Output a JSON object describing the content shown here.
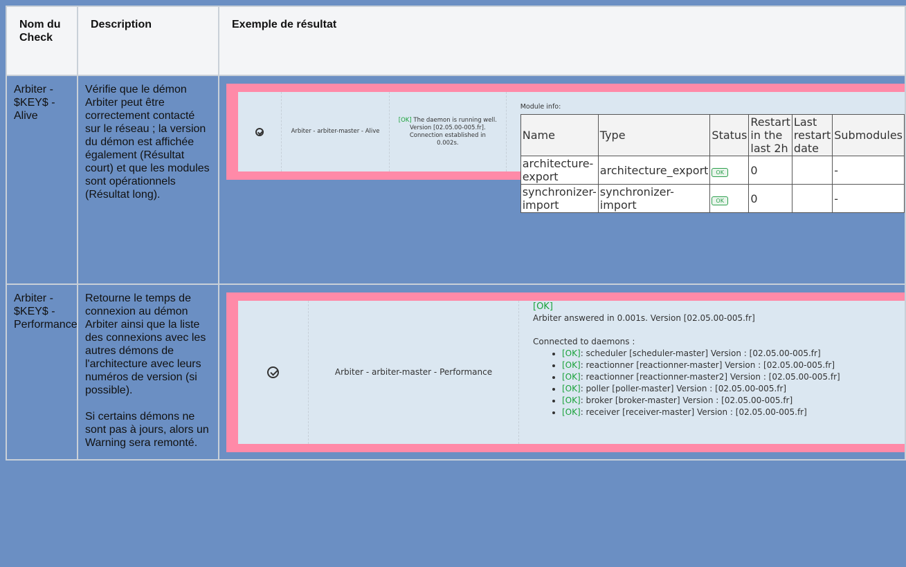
{
  "table": {
    "headers": [
      "Nom du Check",
      "Description",
      "Exemple de résultat"
    ],
    "rows": [
      {
        "name": "Arbiter - $KEY$ - Alive",
        "description": [
          "Vérifie que le démon Arbiter peut être correctement contacté sur le réseau ; la version du démon est affichée également (Résultat court) et que les modules sont opérationnels (Résultat long)."
        ],
        "example": {
          "check_name": "Arbiter - arbiter-master - Alive",
          "short_ok": "[OK]",
          "short_text": "The daemon is running well. Version [02.05.00-005.fr]. Connection established in 0.002s.",
          "module_title": "Module info:",
          "module_headers": [
            "Name",
            "Type",
            "Status",
            "Restart in the last 2h",
            "Last restart date",
            "Submodules"
          ],
          "modules": [
            {
              "name": "architecture-export",
              "type": "architecture_export",
              "status": "OK",
              "restarts": "0",
              "last_restart": "",
              "submodules": "-"
            },
            {
              "name": "synchronizer-import",
              "type": "synchronizer-import",
              "status": "OK",
              "restarts": "0",
              "last_restart": "",
              "submodules": "-"
            }
          ]
        }
      },
      {
        "name": "Arbiter - $KEY$ - Performance",
        "description": [
          "Retourne le temps de connexion au démon Arbiter ainsi que la liste des connexions avec les autres démons de l'architecture avec leurs numéros de version (si possible).",
          "Si certains démons ne sont pas à jours, alors un Warning sera remonté."
        ],
        "example": {
          "check_name": "Arbiter - arbiter-master - Performance",
          "ok_head": "[OK]",
          "answer_line": "Arbiter answered in 0.001s. Version [02.05.00-005.fr]",
          "connected_title": "Connected to daemons :",
          "daemons": [
            {
              "ok": "[OK]",
              "text": ": scheduler [scheduler-master] Version : [02.05.00-005.fr]"
            },
            {
              "ok": "[OK]",
              "text": ": reactionner [reactionner-master] Version : [02.05.00-005.fr]"
            },
            {
              "ok": "[OK]",
              "text": ": reactionner [reactionner-master2] Version : [02.05.00-005.fr]"
            },
            {
              "ok": "[OK]",
              "text": ": poller [poller-master] Version : [02.05.00-005.fr]"
            },
            {
              "ok": "[OK]",
              "text": ": broker [broker-master] Version : [02.05.00-005.fr]"
            },
            {
              "ok": "[OK]",
              "text": ": receiver [receiver-master] Version : [02.05.00-005.fr]"
            }
          ]
        }
      }
    ]
  },
  "colors": {
    "page_background": "#6b8fc3",
    "screenshot_frame": "#ff8aa8",
    "screenshot_background": "#dbe7f1",
    "ok_green": "#1aa23a"
  },
  "icons": [
    "check-circle-icon"
  ]
}
